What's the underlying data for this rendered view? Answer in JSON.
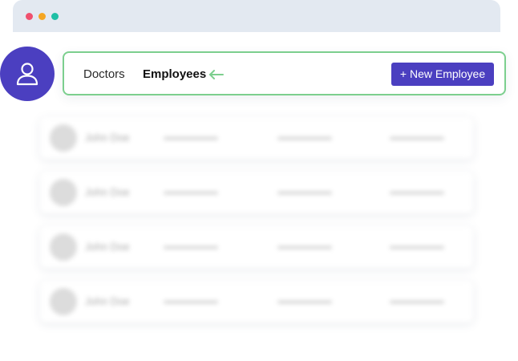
{
  "browser": {
    "window_dots": [
      "red",
      "yellow",
      "green"
    ],
    "dot_colors": [
      "#f0506e",
      "#f5a623",
      "#1fbfa5"
    ]
  },
  "avatar": {
    "icon": "user-icon",
    "color": "#4b3fc0"
  },
  "tabs": [
    {
      "label": "Doctors",
      "active": false
    },
    {
      "label": "Employees",
      "active": true
    }
  ],
  "arrow": {
    "icon": "arrow-left-icon",
    "color": "#7ccf8e"
  },
  "new_button": {
    "label": "+ New Employee",
    "color": "#4b3fc0"
  },
  "rows": [
    {
      "name": "John Doe"
    },
    {
      "name": "John Doe"
    },
    {
      "name": "John Doe"
    },
    {
      "name": "John Doe"
    }
  ]
}
